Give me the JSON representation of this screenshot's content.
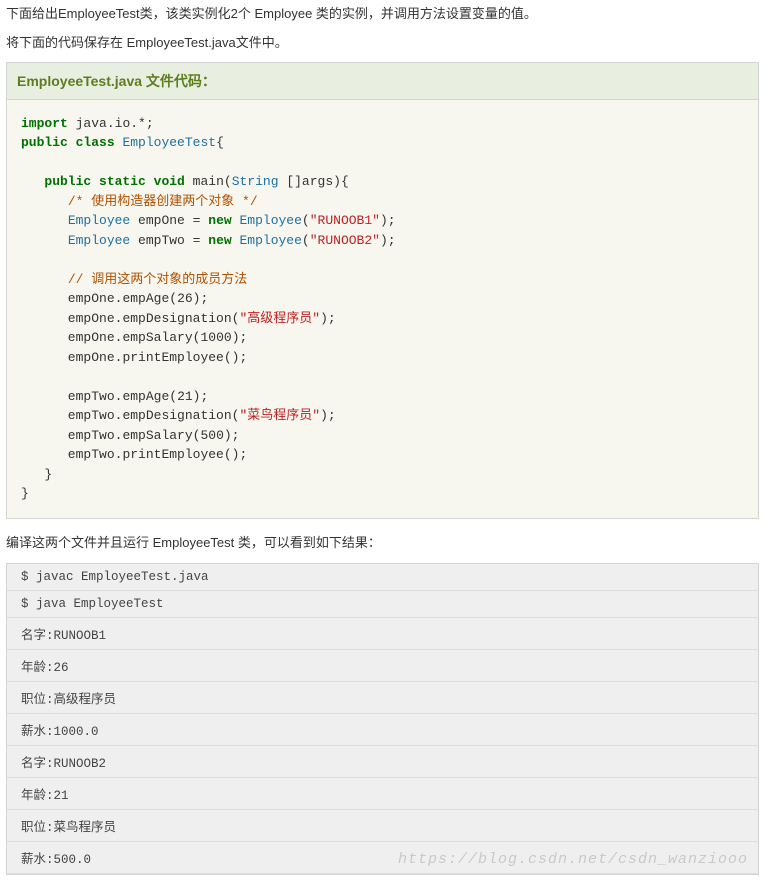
{
  "intro1": "下面给出EmployeeTest类，该类实例化2个 Employee 类的实例，并调用方法设置变量的值。",
  "intro2": "将下面的代码保存在 EmployeeTest.java文件中。",
  "codeTitle": "EmployeeTest.java 文件代码：",
  "code": {
    "l01a": "import",
    "l01b": " java",
    "l01c": ".",
    "l01d": "io",
    "l01e": ".*;",
    "l02a": "public",
    "l02b": " ",
    "l02c": "class",
    "l02d": " ",
    "l02e": "EmployeeTest",
    "l02f": "{",
    "l03": "",
    "l04a": "   ",
    "l04b": "public",
    "l04c": " ",
    "l04d": "static",
    "l04e": " ",
    "l04f": "void",
    "l04g": " main",
    "l04h": "(",
    "l04i": "String",
    "l04j": " []",
    "l04k": "args",
    "l04l": "){",
    "l05a": "      ",
    "l05b": "/* 使用构造器创建两个对象 */",
    "l06a": "      ",
    "l06b": "Employee",
    "l06c": " empOne ",
    "l06d": "=",
    "l06e": " ",
    "l06f": "new",
    "l06g": " ",
    "l06h": "Employee",
    "l06i": "(",
    "l06j": "\"RUNOOB1\"",
    "l06k": ");",
    "l07a": "      ",
    "l07b": "Employee",
    "l07c": " empTwo ",
    "l07d": "=",
    "l07e": " ",
    "l07f": "new",
    "l07g": " ",
    "l07h": "Employee",
    "l07i": "(",
    "l07j": "\"RUNOOB2\"",
    "l07k": ");",
    "l08": "",
    "l09a": "      ",
    "l09b": "// 调用这两个对象的成员方法",
    "l10a": "      empOne",
    "l10b": ".",
    "l10c": "empAge",
    "l10d": "(",
    "l10e": "26",
    "l10f": ");",
    "l11a": "      empOne",
    "l11b": ".",
    "l11c": "empDesignation",
    "l11d": "(",
    "l11e": "\"高级程序员\"",
    "l11f": ");",
    "l12a": "      empOne",
    "l12b": ".",
    "l12c": "empSalary",
    "l12d": "(",
    "l12e": "1000",
    "l12f": ");",
    "l13a": "      empOne",
    "l13b": ".",
    "l13c": "printEmployee",
    "l13d": "();",
    "l14": "",
    "l15a": "      empTwo",
    "l15b": ".",
    "l15c": "empAge",
    "l15d": "(",
    "l15e": "21",
    "l15f": ");",
    "l16a": "      empTwo",
    "l16b": ".",
    "l16c": "empDesignation",
    "l16d": "(",
    "l16e": "\"菜鸟程序员\"",
    "l16f": ");",
    "l17a": "      empTwo",
    "l17b": ".",
    "l17c": "empSalary",
    "l17d": "(",
    "l17e": "500",
    "l17f": ");",
    "l18a": "      empTwo",
    "l18b": ".",
    "l18c": "printEmployee",
    "l18d": "();",
    "l19a": "   ",
    "l19b": "}",
    "l20a": "}"
  },
  "afterCode": "编译这两个文件并且运行 EmployeeTest 类，可以看到如下结果：",
  "term": [
    "$ javac EmployeeTest.java",
    "$ java EmployeeTest",
    "名字:RUNOOB1",
    "年龄:26",
    "职位:高级程序员",
    "薪水:1000.0",
    "名字:RUNOOB2",
    "年龄:21",
    "职位:菜鸟程序员",
    "薪水:500.0"
  ],
  "watermark": "https://blog.csdn.net/csdn_wanziooo"
}
